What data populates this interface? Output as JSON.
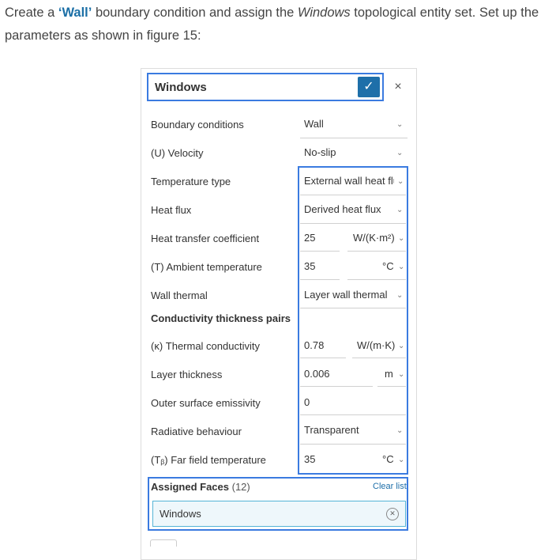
{
  "intro": {
    "part1": "Create a ",
    "wall": "‘Wall’",
    "part2": " boundary condition and assign the ",
    "windows": "Windows",
    "part3": " topological entity set. Set up the parameters as shown in figure 15:"
  },
  "panel": {
    "name": "Windows",
    "confirm_icon": "checkmark-icon",
    "close_icon": "close-icon",
    "rows": {
      "boundary_conditions": {
        "label": "Boundary conditions",
        "value": "Wall"
      },
      "velocity": {
        "label": "(U) Velocity",
        "value": "No-slip"
      },
      "temperature_type": {
        "label": "Temperature type",
        "value": "External wall heat flu"
      },
      "heat_flux": {
        "label": "Heat flux",
        "value": "Derived heat flux"
      },
      "heat_transfer_coefficient": {
        "label": "Heat transfer coefficient",
        "value": "25",
        "unit": "W/(K·m²)"
      },
      "ambient_temperature": {
        "label": "(T) Ambient temperature",
        "value": "35",
        "unit": "°C"
      },
      "wall_thermal": {
        "label": "Wall thermal",
        "value": "Layer wall thermal"
      },
      "conductivity_pairs": {
        "label": "Conductivity thickness pairs"
      },
      "thermal_conductivity": {
        "label": "(κ) Thermal conductivity",
        "value": "0.78",
        "unit": "W/(m·K)"
      },
      "layer_thickness": {
        "label": "Layer thickness",
        "value": "0.006",
        "unit": "m"
      },
      "outer_emissivity": {
        "label": "Outer surface emissivity",
        "value": "0"
      },
      "radiative_behaviour": {
        "label": "Radiative behaviour",
        "value": "Transparent"
      },
      "far_field_temperature": {
        "label": "(Tᵦ) Far field temperature",
        "value": "35",
        "unit": "°C"
      }
    },
    "assigned": {
      "title": "Assigned Faces",
      "count": "(12)",
      "clear": "Clear list",
      "items": [
        "Windows"
      ]
    }
  },
  "colors": {
    "highlight": "#3b7be0",
    "accent": "#1e6fa9",
    "item_bg": "#eef7fb"
  }
}
